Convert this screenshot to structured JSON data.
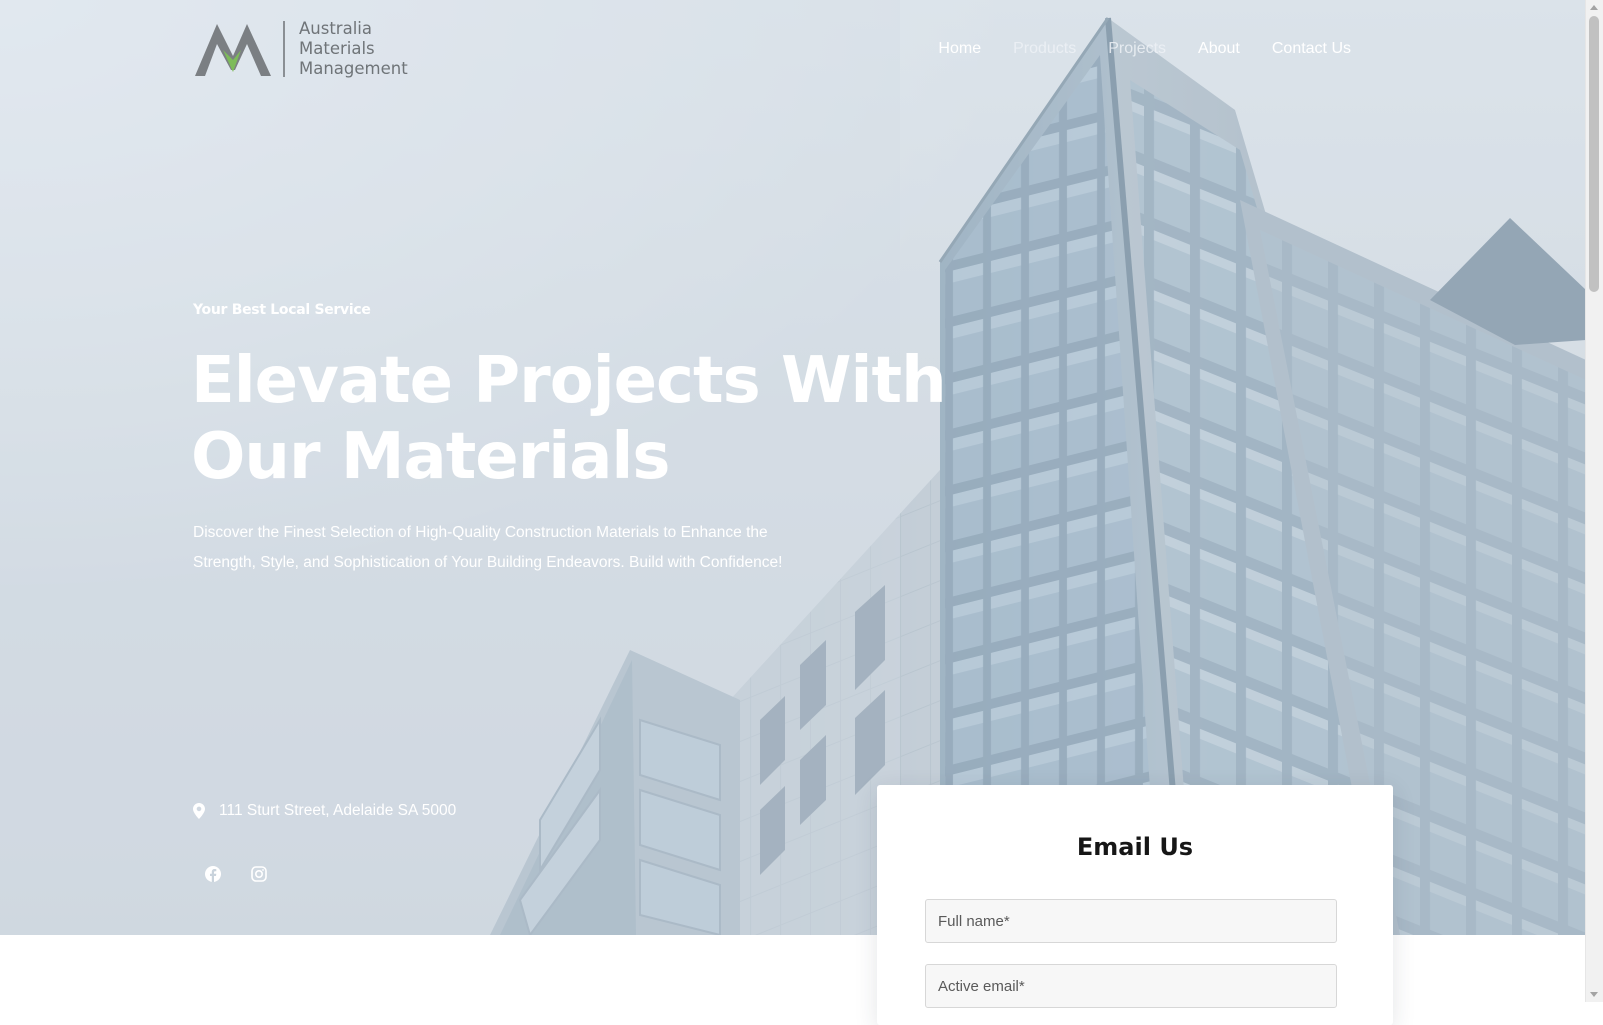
{
  "brand": {
    "name_lines": [
      "Australia",
      "Materials",
      "Management"
    ],
    "colors": {
      "mark_gray": "#7b7f83",
      "mark_green": "#7dbb5a"
    }
  },
  "nav": {
    "items": [
      {
        "label": "Home"
      },
      {
        "label": "Products"
      },
      {
        "label": "Projects"
      },
      {
        "label": "About"
      },
      {
        "label": "Contact Us"
      }
    ]
  },
  "hero": {
    "eyebrow": "Your Best Local Service",
    "headline_line1": "Elevate Projects With",
    "headline_line2": "Our Materials",
    "subtext": "Discover the Finest Selection of High-Quality Construction Materials to Enhance the Strength, Style, and Sophistication of Your Building Endeavors. Build with Confidence!",
    "address": "111 Sturt Street, Adelaide SA 5000",
    "socials": [
      {
        "icon": "facebook-icon"
      },
      {
        "icon": "instagram-icon"
      }
    ]
  },
  "email_form": {
    "title": "Email Us",
    "full_name_placeholder": "Full name*",
    "email_placeholder": "Active email*"
  }
}
